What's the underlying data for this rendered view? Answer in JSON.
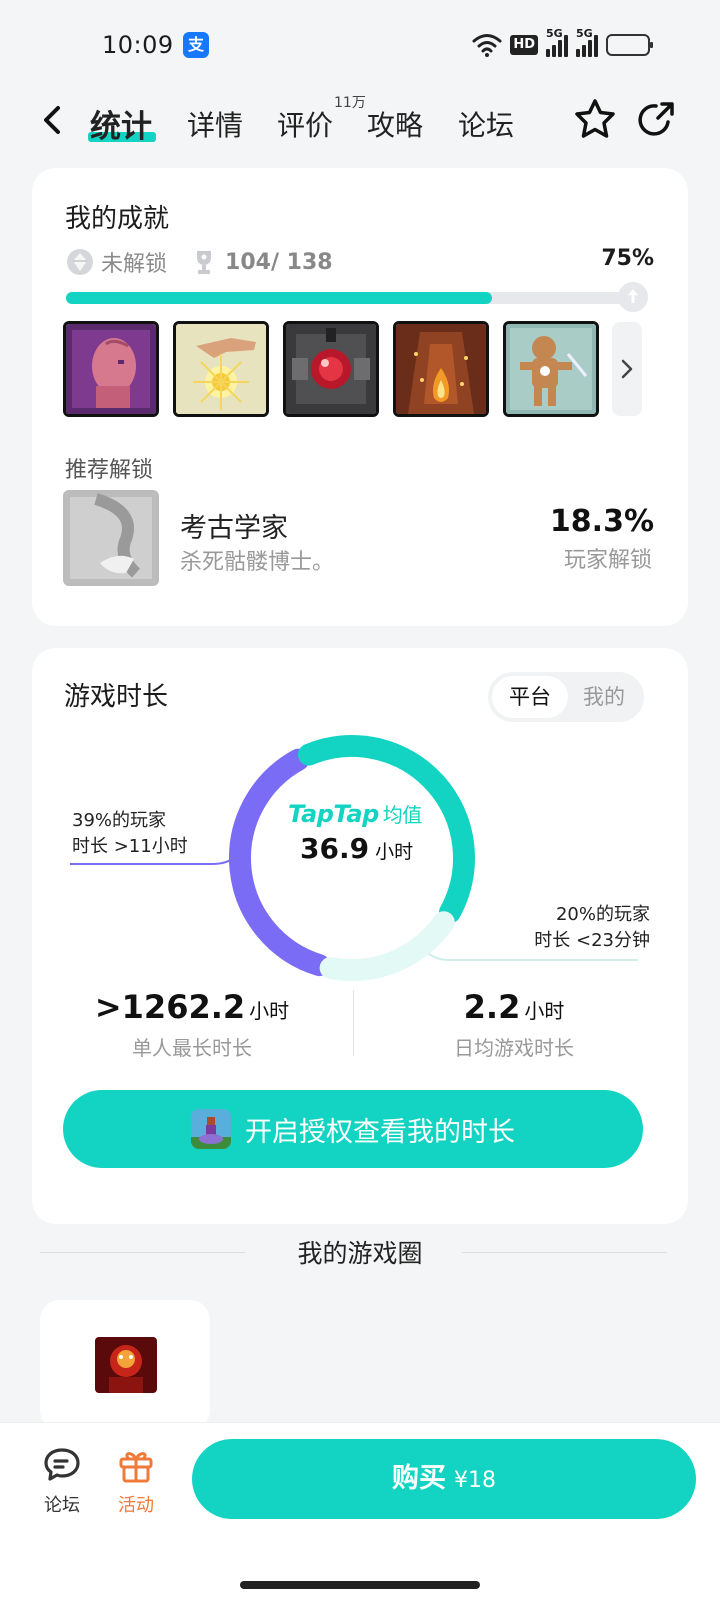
{
  "status_bar": {
    "time": "10:09",
    "alipay_glyph": "支",
    "hd_label": "HD",
    "signal_label": "5G",
    "battery_color": "#f5bd1f"
  },
  "nav": {
    "tabs": [
      {
        "label": "统计",
        "active": true
      },
      {
        "label": "详情",
        "active": false
      },
      {
        "label": "评价",
        "active": false
      },
      {
        "label": "攻略",
        "active": false
      },
      {
        "label": "论坛",
        "active": false
      }
    ],
    "review_badge": "11万",
    "accent": "#13d4c2"
  },
  "achievements": {
    "title": "我的成就",
    "locked_label": "未解锁",
    "count": "104/ 138",
    "percent": "75%",
    "progress": 0.75,
    "badge_icons": [
      "pink-head-badge",
      "golden-hand-badge",
      "red-orb-badge",
      "fire-cave-badge",
      "cookie-man-badge"
    ],
    "recommend_label": "推荐解锁",
    "recommend": {
      "name": "考古学家",
      "desc": "杀死骷髅博士。",
      "percent": "18.3%",
      "percent_label": "玩家解锁"
    }
  },
  "playtime": {
    "title": "游戏时长",
    "toggle": {
      "platform": "平台",
      "mine": "我的"
    },
    "tap_logo": "TapTap",
    "avg_label": "均值",
    "avg_value": "36.9",
    "avg_unit": "小时",
    "legend_left": {
      "line1": "39%的玩家",
      "line2": "时长 >11小时"
    },
    "legend_right": {
      "line1": "20%的玩家",
      "line2": "时长 <23分钟"
    },
    "segments": [
      {
        "name": "long",
        "fraction": 0.39,
        "color": "#7b6cf6"
      },
      {
        "name": "mid",
        "fraction": 0.41,
        "color": "#13d4c2"
      },
      {
        "name": "short",
        "fraction": 0.2,
        "color": "#e2f9f6"
      }
    ],
    "stat_max": {
      "value": ">1262.2",
      "unit": "小时",
      "label": "单人最长时长"
    },
    "stat_daily": {
      "value": "2.2",
      "unit": "小时",
      "label": "日均游戏时长"
    },
    "auth_button": "开启授权查看我的时长"
  },
  "circle": {
    "title": "我的游戏圈"
  },
  "bottom_bar": {
    "forum_label": "论坛",
    "event_label": "活动",
    "event_color": "#f07a3a",
    "buy_label": "购买",
    "buy_price": "¥18"
  }
}
